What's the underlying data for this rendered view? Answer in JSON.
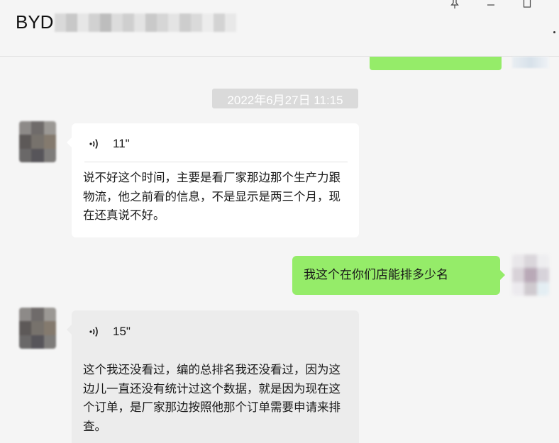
{
  "window": {
    "title_prefix": "BYD",
    "buttons": [
      "pin",
      "minimize",
      "maximize"
    ]
  },
  "conversation": {
    "timestamp": "2022年6月27日 11:15",
    "messages": [
      {
        "side": "left",
        "type": "voice",
        "duration": "11\"",
        "transcript": "说不好这个时间，主要是看厂家那边那个生产力跟物流，他之前看的信息，不是显示是两三个月，现在还真说不好。"
      },
      {
        "side": "right",
        "type": "text",
        "text": "我这个在你们店能排多少名"
      },
      {
        "side": "left",
        "type": "voice",
        "duration": "15\"",
        "transcript": "这个我还没看过，编的总排名我还没看过，因为这边儿一直还没有统计过这个数据，就是因为现在这个订单，是厂家那边按照他那个订单需要申请来排查。"
      }
    ]
  },
  "colors": {
    "background": "#f5f5f5",
    "sent_bubble": "#95ec69",
    "received_bubble": "#ffffff",
    "received_bubble_selected": "#ececec",
    "timestamp_bg": "#dadada"
  }
}
